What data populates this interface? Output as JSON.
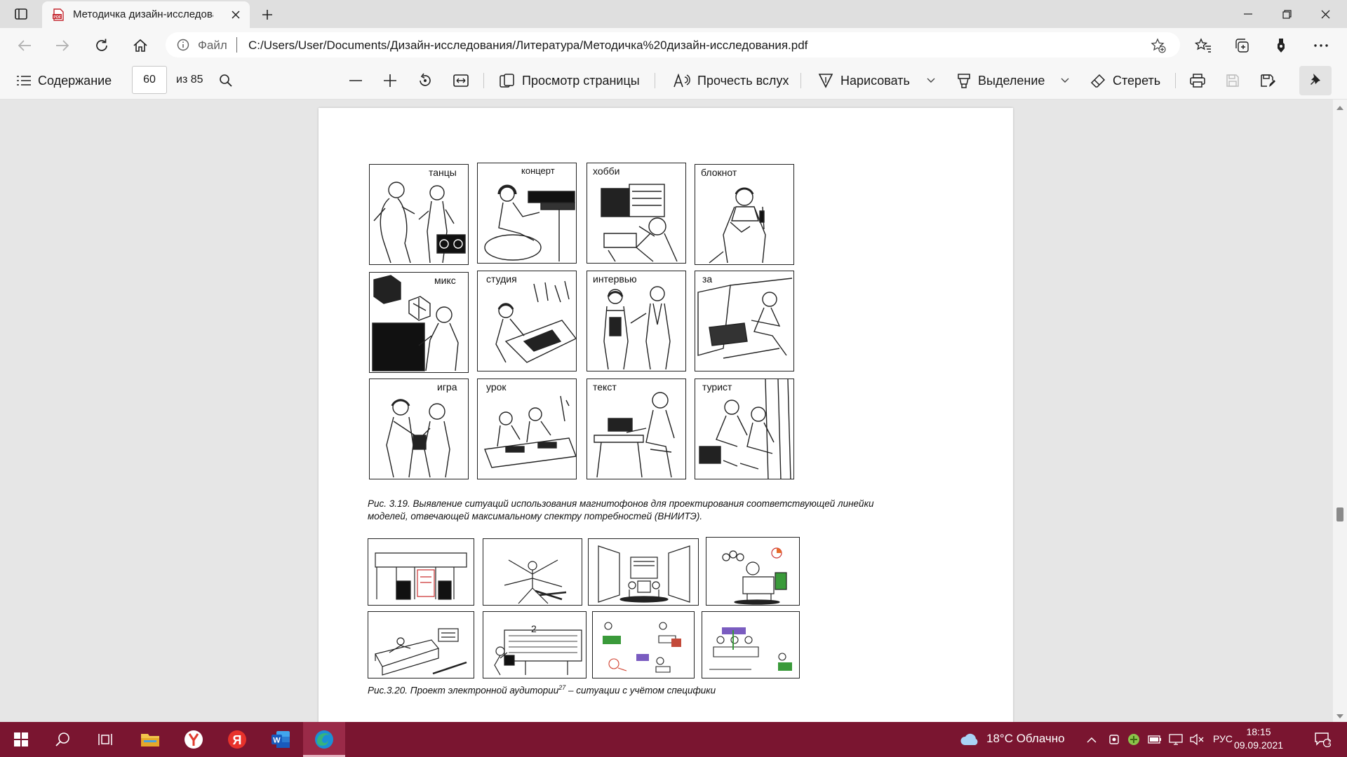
{
  "browser": {
    "tab_title": "Методичка дизайн-исследован",
    "url_scheme": "Файл",
    "url": "C:/Users/User/Documents/Дизайн-исследования/Литература/Методичка%20дизайн-исследования.pdf"
  },
  "pdf_toolbar": {
    "contents_label": "Содержание",
    "page_number": "60",
    "page_total": "из 85",
    "page_view_label": "Просмотр страницы",
    "read_aloud_label": "Прочесть вслух",
    "draw_label": "Нарисовать",
    "highlight_label": "Выделение",
    "erase_label": "Стереть"
  },
  "document": {
    "figure_319_labels": [
      "танцы",
      "концерт",
      "хобби",
      "блокнот",
      "микс",
      "студия",
      "интервью",
      "за",
      "игра",
      "урок",
      "текст",
      "турист"
    ],
    "figure_319_caption_line1": "Рис. 3.19. Выявление ситуаций использования магнитофонов для проектирования соответствующей линейки",
    "figure_319_caption_line2": "моделей, отвечающей максимальному спектру потребностей (ВНИИТЭ).",
    "figure_320_panel_number": "2",
    "figure_320_caption": "Рис.3.20. Проект электронной аудитории",
    "figure_320_footnote": "27",
    "figure_320_caption_tail": " – ситуации с учётом специфики"
  },
  "taskbar": {
    "weather": "18°C Облачно",
    "language": "РУС",
    "time": "18:15",
    "date": "09.09.2021",
    "notifications": "1"
  },
  "colors": {
    "taskbar": "#7a1530",
    "active_task": "#9a2a48",
    "pdf_icon": "#c4262e",
    "edge_blue": "#1b8fd6",
    "edge_green": "#36b37e"
  }
}
